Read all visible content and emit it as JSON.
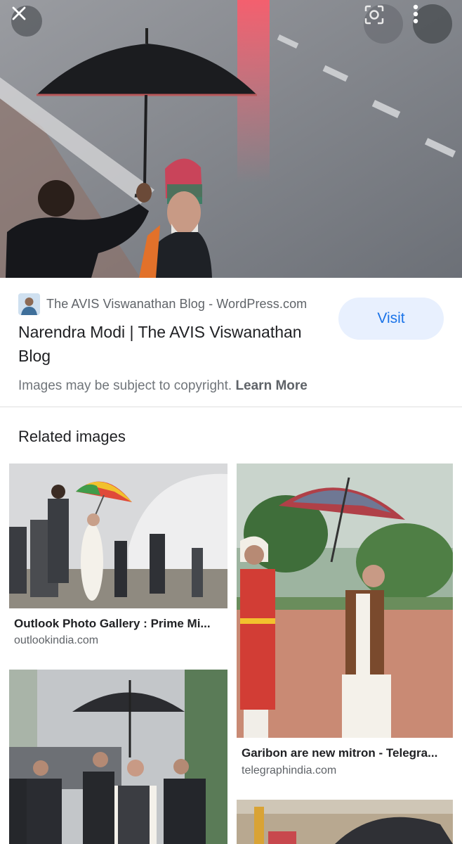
{
  "viewer": {
    "close_icon": "close-icon",
    "lens_icon": "lens-icon",
    "more_icon": "more-vert-icon"
  },
  "result": {
    "source_name": "The AVIS Viswanathan Blog - WordPress.com",
    "title": "Narendra Modi | The AVIS Viswanathan Blog",
    "visit_label": "Visit",
    "copyright_text": "Images may be subject to copyright.",
    "learn_more_label": "Learn More"
  },
  "related": {
    "heading": "Related images",
    "items": [
      {
        "title": "Outlook Photo Gallery : Prime Mi...",
        "domain": "outlookindia.com"
      },
      {
        "title": "Garibon are new mitron - Telegra...",
        "domain": "telegraphindia.com"
      }
    ]
  },
  "colors": {
    "accent": "#1a73e8",
    "visit_bg": "#e8f0fe",
    "divider": "#e0e0e0"
  }
}
